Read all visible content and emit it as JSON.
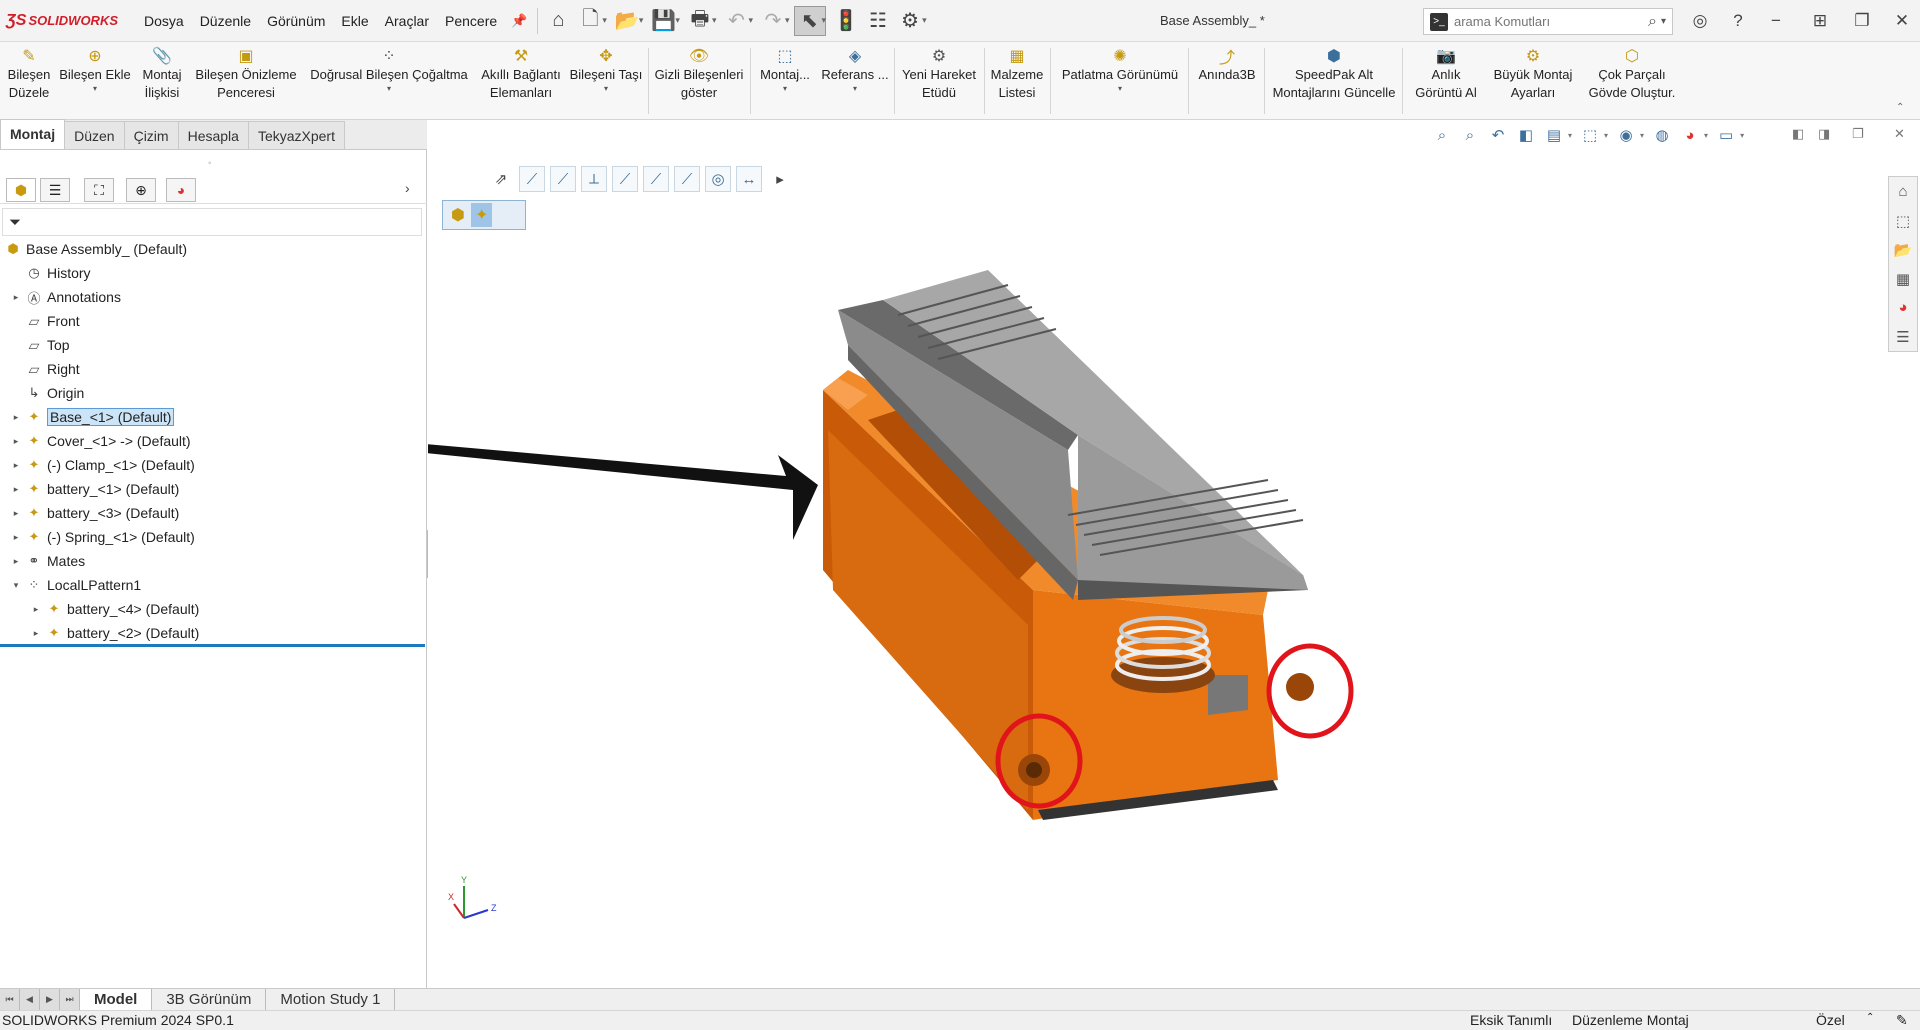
{
  "titlebar": {
    "logo": "SOLIDWORKS",
    "menus": [
      "Dosya",
      "Düzenle",
      "Görünüm",
      "Ekle",
      "Araçlar",
      "Pencere"
    ],
    "document_title": "Base Assembly_ *",
    "search_placeholder": "arama Komutları"
  },
  "ribbon": {
    "buttons": [
      {
        "label": "Bileşen\nDüzele",
        "icon": "edit-component-icon"
      },
      {
        "label": "Bileşen Ekle",
        "icon": "insert-component-icon"
      },
      {
        "label": "Montaj\nİlişkisi",
        "icon": "mate-icon"
      },
      {
        "label": "Bileşen Önizleme\nPenceresi",
        "icon": "preview-window-icon"
      },
      {
        "label": "Doğrusal Bileşen Çoğaltma",
        "icon": "linear-pattern-icon"
      },
      {
        "label": "Akıllı Bağlantı\nElemanları",
        "icon": "smart-fasteners-icon"
      },
      {
        "label": "Bileşeni Taşı",
        "icon": "move-component-icon"
      },
      {
        "label": "Gizli Bileşenleri\ngöster",
        "icon": "show-hidden-icon"
      },
      {
        "label": "Montaj...",
        "icon": "assembly-features-icon"
      },
      {
        "label": "Referans ...",
        "icon": "reference-geometry-icon"
      },
      {
        "label": "Yeni Hareket\nEtüdü",
        "icon": "motion-study-icon"
      },
      {
        "label": "Malzeme\nListesi",
        "icon": "bom-icon"
      },
      {
        "label": "Patlatma Görünümü",
        "icon": "exploded-view-icon"
      },
      {
        "label": "Anında3B",
        "icon": "instant3d-icon"
      },
      {
        "label": "SpeedPak Alt\nMontajlarını Güncelle",
        "icon": "speedpak-icon"
      },
      {
        "label": "Anlık\nGörüntü Al",
        "icon": "snapshot-icon"
      },
      {
        "label": "Büyük Montaj\nAyarları",
        "icon": "large-assembly-icon"
      },
      {
        "label": "Çok Parçalı\nGövde Oluştur.",
        "icon": "multibody-icon"
      }
    ]
  },
  "command_tabs": [
    "Montaj",
    "Düzen",
    "Çizim",
    "Hesapla",
    "TekyazXpert"
  ],
  "tree": {
    "root": "Base Assembly_ (Default)",
    "items": [
      {
        "label": "History"
      },
      {
        "label": "Annotations"
      },
      {
        "label": "Front"
      },
      {
        "label": "Top"
      },
      {
        "label": "Right"
      },
      {
        "label": "Origin"
      },
      {
        "label": "Base_<1> (Default)"
      },
      {
        "label": "Cover_<1> -> (Default)"
      },
      {
        "label": "(-) Clamp_<1> (Default)"
      },
      {
        "label": "battery_<1> (Default)"
      },
      {
        "label": "battery_<3> (Default)"
      },
      {
        "label": "(-) Spring_<1> (Default)"
      },
      {
        "label": "Mates"
      },
      {
        "label": "LocalLPattern1"
      },
      {
        "label": "battery_<4> (Default)"
      },
      {
        "label": "battery_<2> (Default)"
      }
    ]
  },
  "triad": {
    "x": "X",
    "y": "Y",
    "z": "Z"
  },
  "bottom_tabs": [
    "Model",
    "3B Görünüm",
    "Motion Study 1"
  ],
  "status": {
    "app": "SOLIDWORKS Premium 2024 SP0.1",
    "definition": "Eksik Tanımlı",
    "mode": "Düzenleme Montaj",
    "units": "Özel"
  },
  "colors": {
    "brand_red": "#d01f2a",
    "part_orange": "#e87512",
    "cover_gray": "#a7a7a7",
    "highlight_red": "#e0141a",
    "selection_blue": "#cce4f7"
  }
}
